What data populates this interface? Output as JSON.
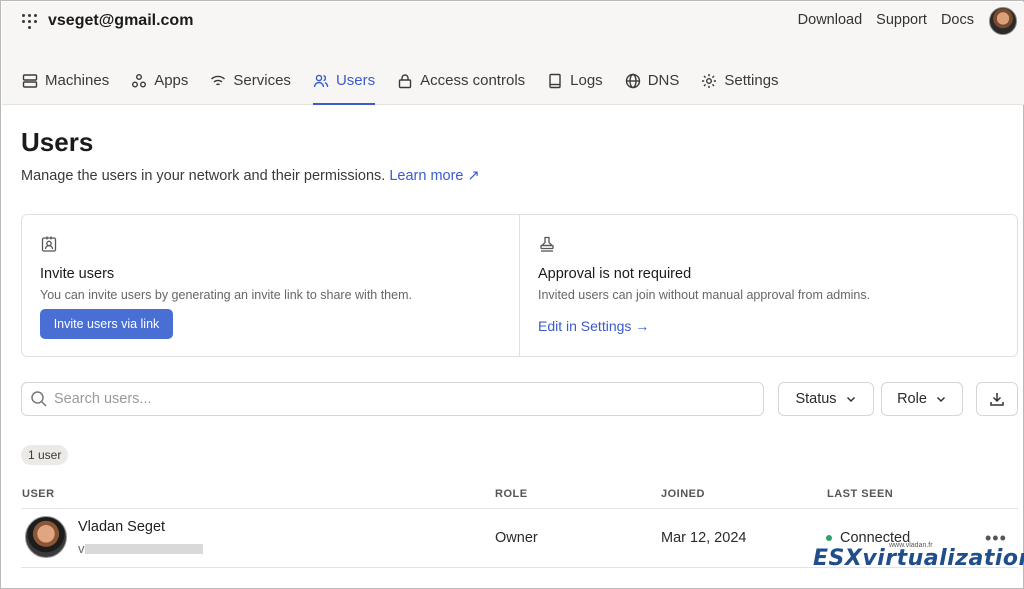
{
  "header": {
    "account": "vseget@gmail.com",
    "links": [
      "Download",
      "Support",
      "Docs"
    ]
  },
  "nav": {
    "items": [
      {
        "label": "Machines",
        "icon": "machines-icon"
      },
      {
        "label": "Apps",
        "icon": "apps-icon"
      },
      {
        "label": "Services",
        "icon": "wifi-icon"
      },
      {
        "label": "Users",
        "icon": "users-icon",
        "active": true
      },
      {
        "label": "Access controls",
        "icon": "lock-icon"
      },
      {
        "label": "Logs",
        "icon": "book-icon"
      },
      {
        "label": "DNS",
        "icon": "globe-icon"
      },
      {
        "label": "Settings",
        "icon": "gear-icon"
      }
    ]
  },
  "page": {
    "title": "Users",
    "description": "Manage the users in your network and their permissions.",
    "learn_more": "Learn more ↗"
  },
  "cards": {
    "invite": {
      "title": "Invite users",
      "text": "You can invite users by generating an invite link to share with them.",
      "button": "Invite users via link"
    },
    "approval": {
      "title": "Approval is not required",
      "text": "Invited users can join without manual approval from admins.",
      "link": "Edit in Settings →"
    }
  },
  "toolbar": {
    "search_placeholder": "Search users...",
    "status_filter": "Status",
    "role_filter": "Role"
  },
  "table": {
    "count": "1 user",
    "headers": [
      "USER",
      "ROLE",
      "JOINED",
      "LAST SEEN"
    ],
    "rows": [
      {
        "name": "Vladan Seget",
        "email": "v",
        "role": "Owner",
        "joined": "Mar 12, 2024",
        "last_seen": "Connected",
        "status_color": "#2ea26b"
      }
    ]
  },
  "watermark": {
    "url": "www.vladan.fr",
    "brand": "ESXvirtualization"
  },
  "colors": {
    "accent": "#3b5bcc",
    "button": "#4a6fd4"
  }
}
